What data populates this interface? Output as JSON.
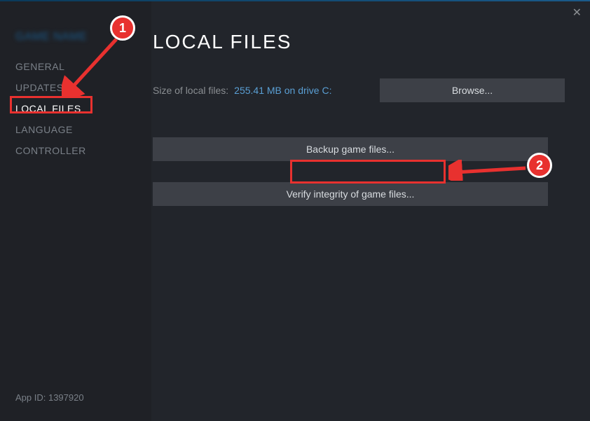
{
  "game_title": "GAME NAME",
  "sidebar": {
    "items": [
      {
        "label": "GENERAL"
      },
      {
        "label": "UPDATES"
      },
      {
        "label": "LOCAL FILES"
      },
      {
        "label": "LANGUAGE"
      },
      {
        "label": "CONTROLLER"
      }
    ]
  },
  "app_id_label": "App ID: 1397920",
  "page": {
    "title": "LOCAL FILES",
    "size_label": "Size of local files:",
    "size_value": "255.41 MB on drive C:",
    "browse_label": "Browse...",
    "backup_label": "Backup game files...",
    "verify_label": "Verify integrity of game files..."
  },
  "annotations": {
    "badge1": "1",
    "badge2": "2"
  }
}
